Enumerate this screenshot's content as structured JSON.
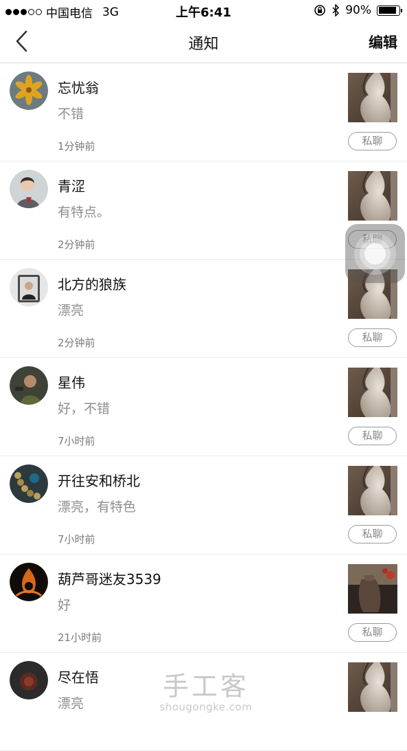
{
  "status": {
    "carrier": "中国电信",
    "network": "3G",
    "time": "上午6:41",
    "battery": "90%",
    "battery_level": 0.9
  },
  "nav": {
    "title": "通知",
    "edit": "编辑"
  },
  "chat_label": "私聊",
  "items": [
    {
      "name": "忘忧翁",
      "comment": "不错",
      "time": "1分钟前"
    },
    {
      "name": "青涩",
      "comment": "有特点。",
      "time": "2分钟前"
    },
    {
      "name": "北方的狼族",
      "comment": "漂亮",
      "time": "2分钟前"
    },
    {
      "name": "星伟",
      "comment": "好，不错",
      "time": "7小时前"
    },
    {
      "name": "开往安和桥北",
      "comment": "漂亮，有特色",
      "time": "7小时前"
    },
    {
      "name": "葫芦哥迷友3539",
      "comment": "好",
      "time": "21小时前"
    },
    {
      "name": "尽在悟",
      "comment": "漂亮",
      "time": ""
    }
  ],
  "watermark": {
    "logo": "手工客",
    "url": "shougongke.com"
  }
}
